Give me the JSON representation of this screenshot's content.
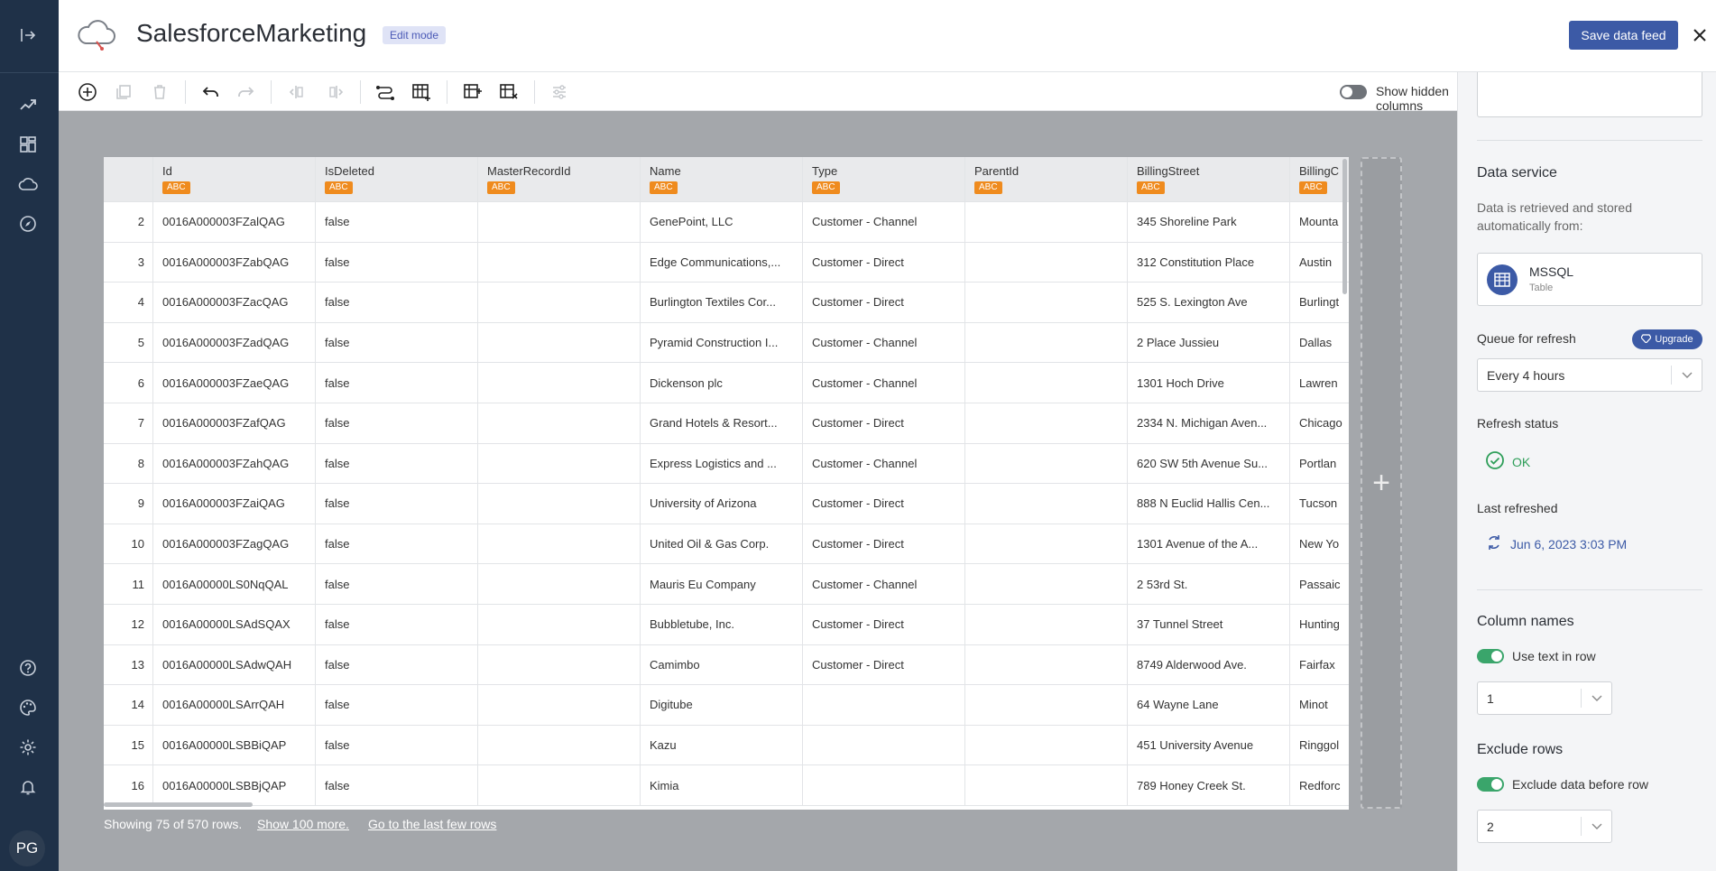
{
  "app": {
    "title": "SalesforceMarketing",
    "mode_badge": "Edit mode",
    "save_label": "Save data feed"
  },
  "toolbar": {
    "show_hidden_label": "Show hidden columns",
    "show_hidden_on": false,
    "icons": [
      "add-icon",
      "duplicate-icon",
      "delete-icon",
      "undo-icon",
      "redo-icon",
      "move-left-icon",
      "move-right-icon",
      "transform-icon",
      "insert-column-icon",
      "add-table-icon",
      "remove-table-icon",
      "filter-settings-icon"
    ]
  },
  "table": {
    "columns": [
      {
        "name": "Id",
        "type": "ABC"
      },
      {
        "name": "IsDeleted",
        "type": "ABC"
      },
      {
        "name": "MasterRecordId",
        "type": "ABC"
      },
      {
        "name": "Name",
        "type": "ABC"
      },
      {
        "name": "Type",
        "type": "ABC"
      },
      {
        "name": "ParentId",
        "type": "ABC"
      },
      {
        "name": "BillingStreet",
        "type": "ABC"
      },
      {
        "name": "BillingC",
        "type": "ABC"
      }
    ],
    "rows": [
      {
        "n": "2",
        "cells": [
          "0016A000003FZalQAG",
          "false",
          "",
          "GenePoint, LLC",
          "Customer - Channel",
          "",
          "345 Shoreline Park",
          "Mounta"
        ]
      },
      {
        "n": "3",
        "cells": [
          "0016A000003FZabQAG",
          "false",
          "",
          "Edge Communications,...",
          "Customer - Direct",
          "",
          "312 Constitution Place",
          "Austin"
        ]
      },
      {
        "n": "4",
        "cells": [
          "0016A000003FZacQAG",
          "false",
          "",
          "Burlington Textiles Cor...",
          "Customer - Direct",
          "",
          "525 S. Lexington Ave",
          "Burlingt"
        ]
      },
      {
        "n": "5",
        "cells": [
          "0016A000003FZadQAG",
          "false",
          "",
          "Pyramid Construction I...",
          "Customer - Channel",
          "",
          "2 Place Jussieu",
          "Dallas"
        ]
      },
      {
        "n": "6",
        "cells": [
          "0016A000003FZaeQAG",
          "false",
          "",
          "Dickenson plc",
          "Customer - Channel",
          "",
          "1301 Hoch Drive",
          "Lawren"
        ]
      },
      {
        "n": "7",
        "cells": [
          "0016A000003FZafQAG",
          "false",
          "",
          "Grand Hotels & Resort...",
          "Customer - Direct",
          "",
          "2334 N. Michigan Aven...",
          "Chicago"
        ]
      },
      {
        "n": "8",
        "cells": [
          "0016A000003FZahQAG",
          "false",
          "",
          "Express Logistics and ...",
          "Customer - Channel",
          "",
          "620 SW 5th Avenue Su...",
          "Portlan"
        ]
      },
      {
        "n": "9",
        "cells": [
          "0016A000003FZaiQAG",
          "false",
          "",
          "University of Arizona",
          "Customer - Direct",
          "",
          "888 N Euclid Hallis Cen...",
          "Tucson"
        ]
      },
      {
        "n": "10",
        "cells": [
          "0016A000003FZagQAG",
          "false",
          "",
          "United Oil & Gas Corp.",
          "Customer - Direct",
          "",
          "1301 Avenue of the A...",
          "New Yo"
        ]
      },
      {
        "n": "11",
        "cells": [
          "0016A00000LS0NqQAL",
          "false",
          "",
          "Mauris Eu Company",
          "Customer - Channel",
          "",
          "2 53rd St.",
          "Passaic"
        ]
      },
      {
        "n": "12",
        "cells": [
          "0016A00000LSAdSQAX",
          "false",
          "",
          "Bubbletube, Inc.",
          "Customer - Direct",
          "",
          "37 Tunnel Street",
          "Hunting"
        ]
      },
      {
        "n": "13",
        "cells": [
          "0016A00000LSAdwQAH",
          "false",
          "",
          "Camimbo",
          "Customer - Direct",
          "",
          "8749 Alderwood Ave.",
          "Fairfax"
        ]
      },
      {
        "n": "14",
        "cells": [
          "0016A00000LSArrQAH",
          "false",
          "",
          "Digitube",
          "",
          "",
          "64 Wayne Lane",
          "Minot"
        ]
      },
      {
        "n": "15",
        "cells": [
          "0016A00000LSBBiQAP",
          "false",
          "",
          "Kazu",
          "",
          "",
          "451 University Avenue",
          "Ringgol"
        ]
      },
      {
        "n": "16",
        "cells": [
          "0016A00000LSBBjQAP",
          "false",
          "",
          "Kimia",
          "",
          "",
          "789 Honey Creek St.",
          "Redforc"
        ]
      }
    ],
    "footer": {
      "showing": "Showing 75 of 570 rows.",
      "show_more": "Show 100 more.",
      "last_rows": "Go to the last few rows"
    }
  },
  "panel": {
    "data_service_title": "Data service",
    "data_service_desc": "Data is retrieved and stored automatically from:",
    "source_name": "MSSQL",
    "source_type": "Table",
    "queue_label": "Queue for refresh",
    "upgrade_label": "Upgrade",
    "queue_value": "Every 4 hours",
    "refresh_status_label": "Refresh status",
    "refresh_status": "OK",
    "last_refreshed_label": "Last refreshed",
    "last_refreshed": "Jun 6, 2023 3:03 PM",
    "column_names_title": "Column names",
    "use_text_label": "Use text in row",
    "use_text_on": true,
    "use_text_row": "1",
    "exclude_rows_title": "Exclude rows",
    "exclude_label": "Exclude data before row",
    "exclude_on": true,
    "exclude_row": "2"
  },
  "user": {
    "initials": "PG"
  },
  "colors": {
    "nav": "#1f3148",
    "accent": "#3c5aa6",
    "type_badge": "#ef8b1e",
    "ok": "#2e9e59"
  }
}
